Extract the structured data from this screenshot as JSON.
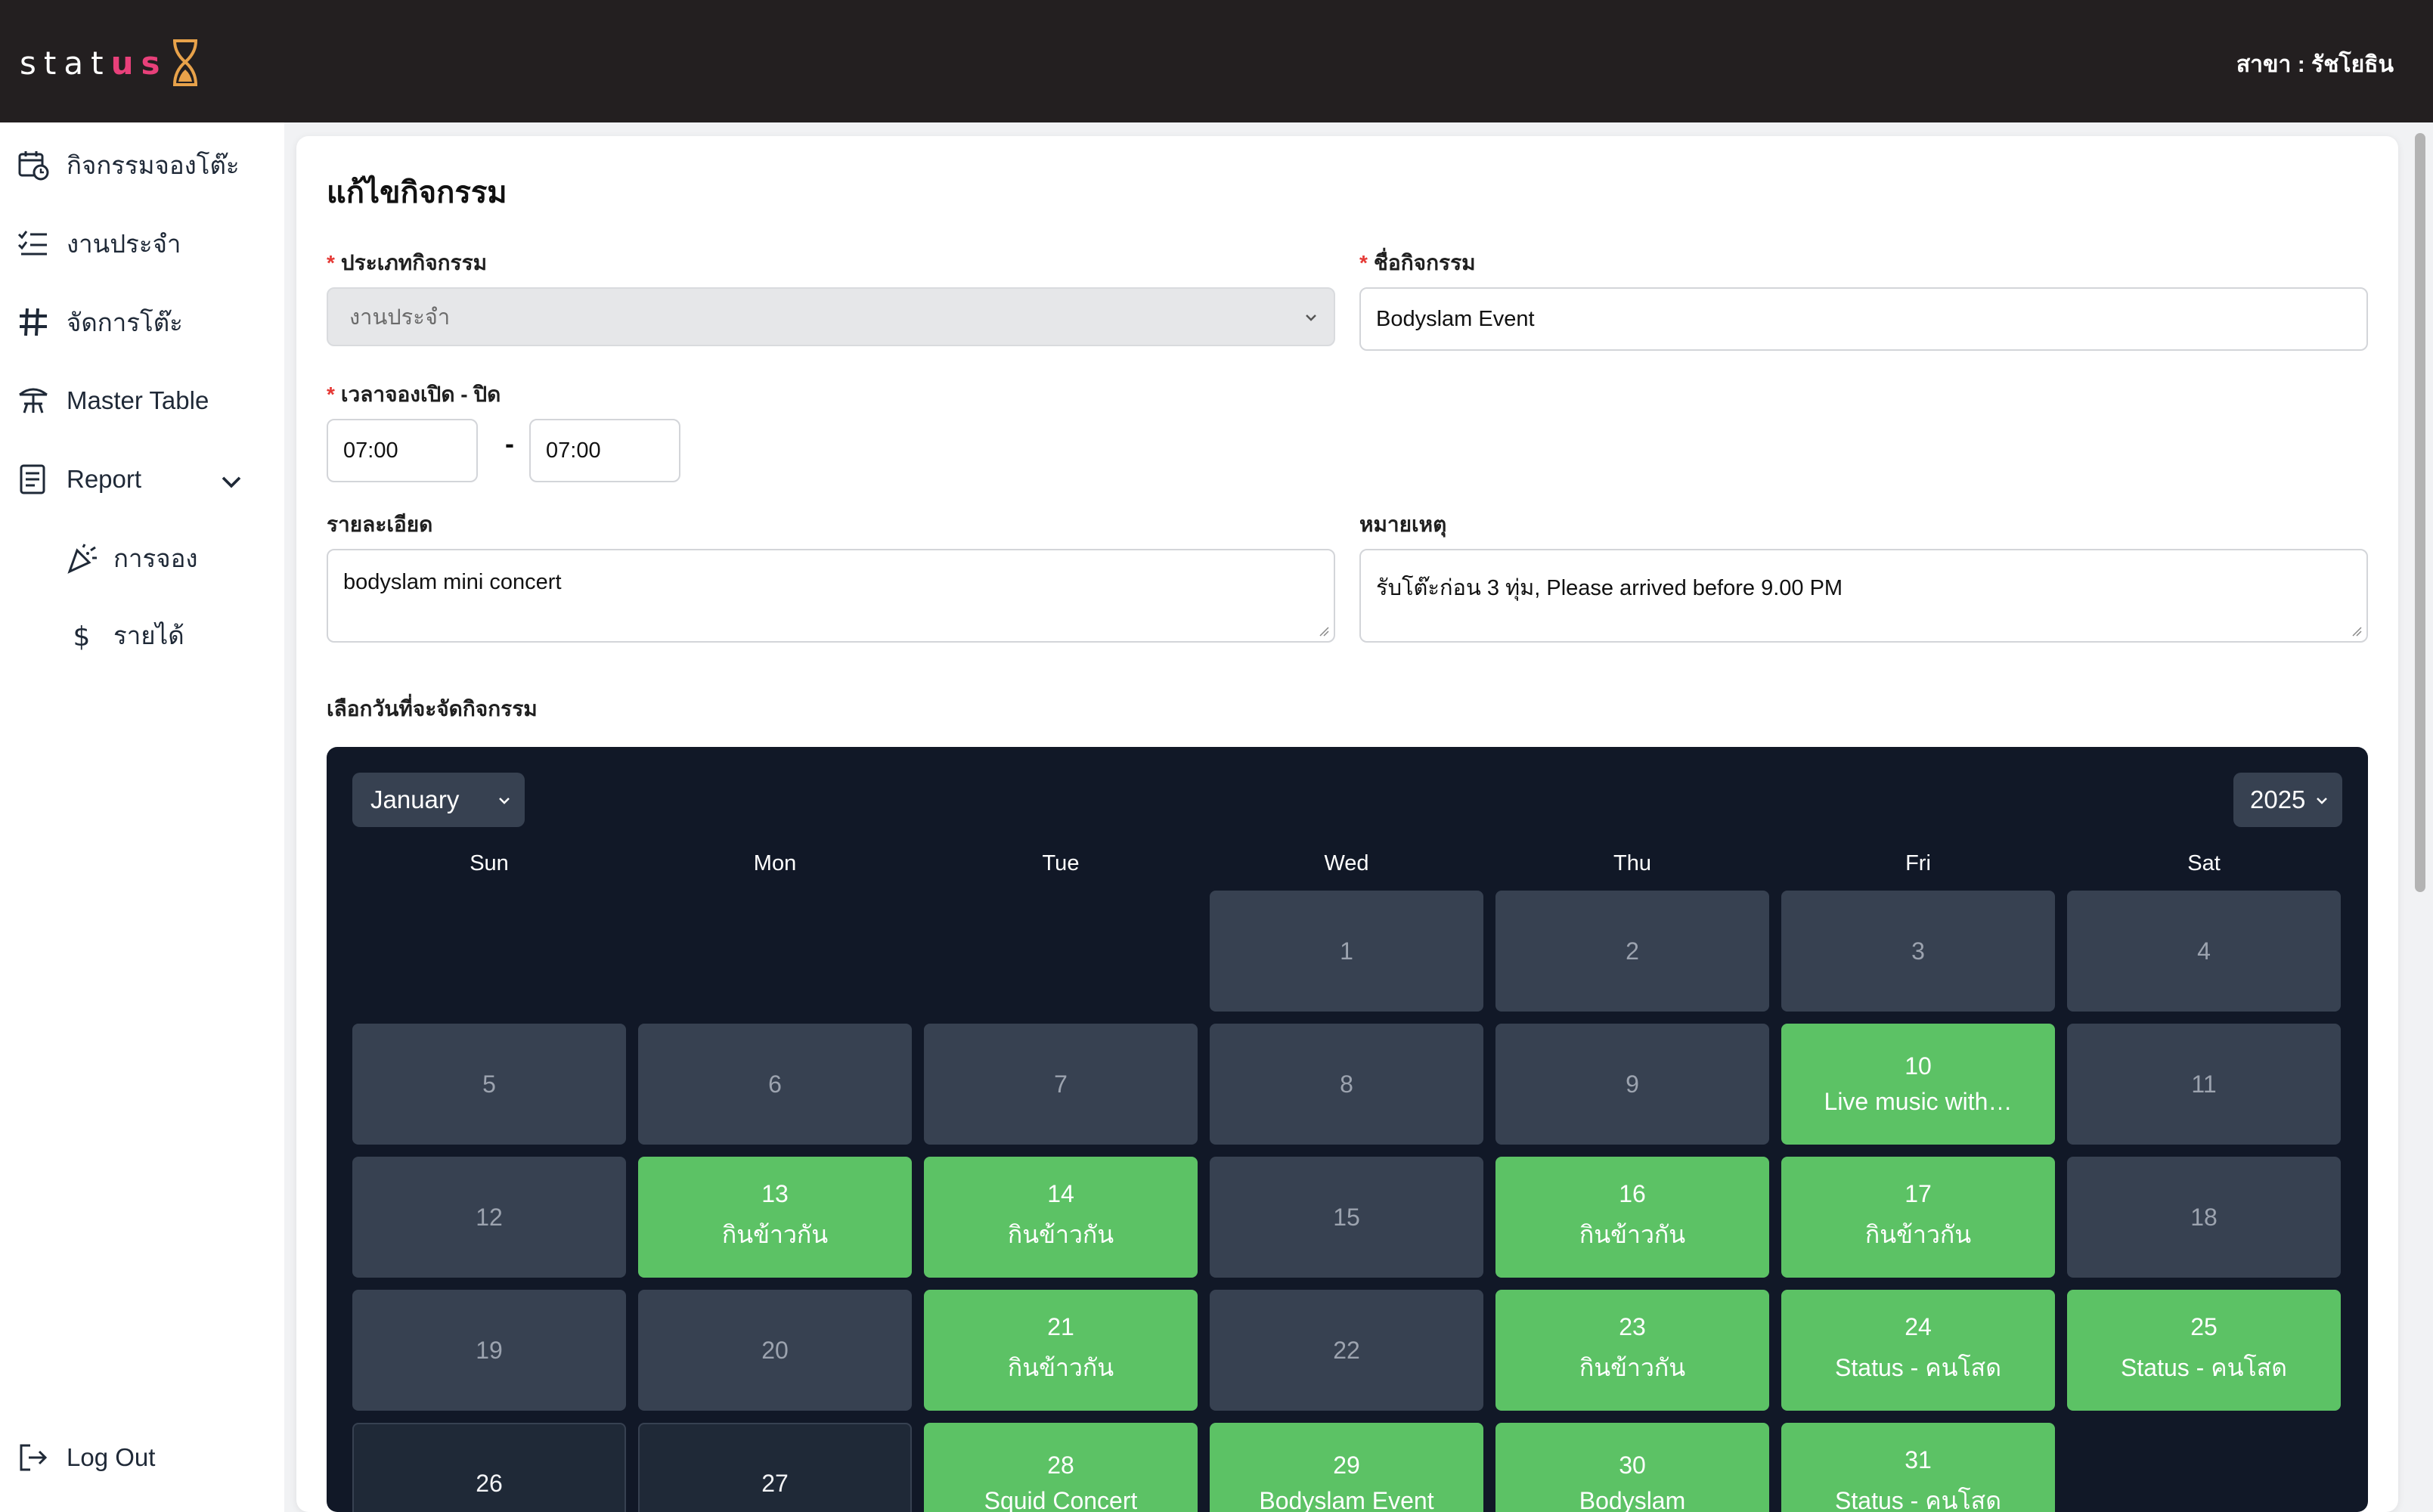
{
  "header": {
    "logo": {
      "pre": "stat",
      "accent": "us"
    },
    "branch": "สาขา : รัชโยธิน"
  },
  "sidebar": {
    "items": [
      {
        "label": "กิจกรรมจองโต๊ะ",
        "icon": "calendar-clock-icon"
      },
      {
        "label": "งานประจำ",
        "icon": "checklist-icon"
      },
      {
        "label": "จัดการโต๊ะ",
        "icon": "grid-icon"
      },
      {
        "label": "Master Table",
        "icon": "table-umbrella-icon"
      },
      {
        "label": "Report",
        "icon": "report-icon"
      }
    ],
    "report_sub": [
      {
        "label": "การจอง",
        "icon": "party-popper-icon"
      },
      {
        "label": "รายได้",
        "icon": "dollar-icon"
      }
    ],
    "logout": "Log Out"
  },
  "form": {
    "title": "แก้ไขกิจกรรม",
    "type_label": "ประเภทกิจกรรม",
    "type_value": "งานประจำ",
    "name_label": "ชื่อกิจกรรม",
    "name_value": "Bodyslam Event",
    "time_label": "เวลาจองเปิด - ปิด",
    "time_open": "07:00",
    "time_close": "07:00",
    "time_sep": "-",
    "detail_label": "รายละเอียด",
    "detail_value": "bodyslam mini concert",
    "note_label": "หมายเหตุ",
    "note_value": "รับโต๊ะก่อน 3 ทุ่ม, Please arrived before 9.00 PM",
    "date_label": "เลือกวันที่จะจัดกิจกรรม",
    "required_mark": "*"
  },
  "calendar": {
    "month": "January",
    "year": "2025",
    "weekdays": [
      "Sun",
      "Mon",
      "Tue",
      "Wed",
      "Thu",
      "Fri",
      "Sat"
    ],
    "first_weekday": 3,
    "days": [
      {
        "d": "1",
        "state": "past",
        "event": ""
      },
      {
        "d": "2",
        "state": "past",
        "event": ""
      },
      {
        "d": "3",
        "state": "past",
        "event": ""
      },
      {
        "d": "4",
        "state": "past",
        "event": ""
      },
      {
        "d": "5",
        "state": "past",
        "event": ""
      },
      {
        "d": "6",
        "state": "past",
        "event": ""
      },
      {
        "d": "7",
        "state": "past",
        "event": ""
      },
      {
        "d": "8",
        "state": "past",
        "event": ""
      },
      {
        "d": "9",
        "state": "past",
        "event": ""
      },
      {
        "d": "10",
        "state": "event",
        "event": "Live music with…"
      },
      {
        "d": "11",
        "state": "past",
        "event": ""
      },
      {
        "d": "12",
        "state": "past",
        "event": ""
      },
      {
        "d": "13",
        "state": "event",
        "event": "กินข้าวกัน"
      },
      {
        "d": "14",
        "state": "event",
        "event": "กินข้าวกัน"
      },
      {
        "d": "15",
        "state": "past",
        "event": ""
      },
      {
        "d": "16",
        "state": "event",
        "event": "กินข้าวกัน"
      },
      {
        "d": "17",
        "state": "event",
        "event": "กินข้าวกัน"
      },
      {
        "d": "18",
        "state": "past",
        "event": ""
      },
      {
        "d": "19",
        "state": "past",
        "event": ""
      },
      {
        "d": "20",
        "state": "past",
        "event": ""
      },
      {
        "d": "21",
        "state": "event",
        "event": "กินข้าวกัน"
      },
      {
        "d": "22",
        "state": "past",
        "event": ""
      },
      {
        "d": "23",
        "state": "event",
        "event": "กินข้าวกัน"
      },
      {
        "d": "24",
        "state": "event",
        "event": "Status - คนโสด"
      },
      {
        "d": "25",
        "state": "event",
        "event": "Status - คนโสด"
      },
      {
        "d": "26",
        "state": "empty",
        "event": ""
      },
      {
        "d": "27",
        "state": "empty",
        "event": ""
      },
      {
        "d": "28",
        "state": "event",
        "event": "Squid Concert"
      },
      {
        "d": "29",
        "state": "event",
        "event": "Bodyslam Event"
      },
      {
        "d": "30",
        "state": "event",
        "event": "Bodyslam"
      },
      {
        "d": "31",
        "state": "event",
        "event": "Status - คนโสด"
      }
    ]
  },
  "colors": {
    "topbar": "#231f20",
    "accent": "#e8407a",
    "calendar_bg": "#111827",
    "day_past": "#374151",
    "day_event": "#5cc265",
    "required": "#e53935"
  }
}
